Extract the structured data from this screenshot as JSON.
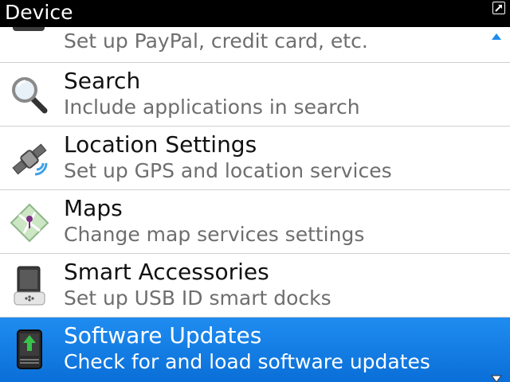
{
  "titlebar": {
    "title": "Device",
    "popout_icon": "popout-arrow-icon"
  },
  "items": [
    {
      "label": "",
      "desc": "Set up PayPal, credit card, etc.",
      "icon": "wallet-icon"
    },
    {
      "label": "Search",
      "desc": "Include applications in search",
      "icon": "magnifier-icon"
    },
    {
      "label": "Location Settings",
      "desc": "Set up GPS and location services",
      "icon": "satellite-icon"
    },
    {
      "label": "Maps",
      "desc": "Change map services settings",
      "icon": "map-icon"
    },
    {
      "label": "Smart Accessories",
      "desc": "Set up USB ID smart docks",
      "icon": "blackberry-device-icon"
    },
    {
      "label": "Software Updates",
      "desc": "Check for and load software updates",
      "icon": "software-update-icon",
      "selected": true
    }
  ],
  "colors": {
    "selection": "#1f8cf0",
    "title_bg": "#000000",
    "secondary_text": "#6e6e6e"
  }
}
